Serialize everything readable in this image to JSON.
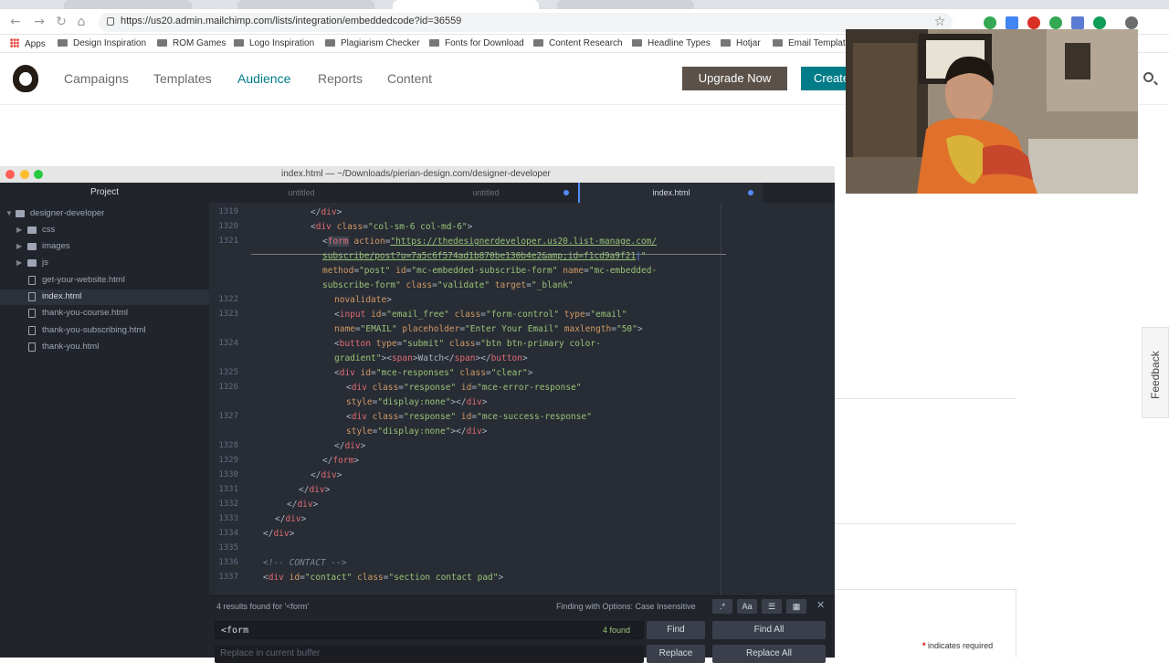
{
  "browser": {
    "url": "https://us20.admin.mailchimp.com/lists/integration/embeddedcode?id=36559",
    "bookmarks": [
      "Apps",
      "Design Inspiration",
      "ROM Games",
      "Logo Inspiration",
      "Plagiarism Checker",
      "Fonts for Download",
      "Content Research",
      "Headline Types",
      "Hotjar",
      "Email Templates"
    ]
  },
  "mailchimp": {
    "nav": [
      "Campaigns",
      "Templates",
      "Audience",
      "Reports",
      "Content"
    ],
    "active_nav": "Audience",
    "upgrade_label": "Upgrade Now",
    "create_label": "Create",
    "feedback_label": "Feedback",
    "required_note": "indicates required",
    "required_mark": "*"
  },
  "editor": {
    "window_title": "index.html — ~/Downloads/pierian-design.com/designer-developer",
    "tree_title": "Project",
    "tree": [
      {
        "label": "designer-developer",
        "kind": "root"
      },
      {
        "label": "css",
        "kind": "folder"
      },
      {
        "label": "images",
        "kind": "folder"
      },
      {
        "label": "js",
        "kind": "folder"
      },
      {
        "label": "get-your-website.html",
        "kind": "file"
      },
      {
        "label": "index.html",
        "kind": "file",
        "selected": true
      },
      {
        "label": "thank-you-course.html",
        "kind": "file"
      },
      {
        "label": "thank-you-subscribing.html",
        "kind": "file"
      },
      {
        "label": "thank-you.html",
        "kind": "file"
      }
    ],
    "tabs": [
      "untitled",
      "untitled",
      "index.html"
    ],
    "active_tab": "index.html",
    "line_numbers": [
      "1319",
      "1320",
      "1321",
      "",
      "",
      "1322",
      "1323",
      "",
      "1324",
      "",
      "1325",
      "1326",
      "",
      "1327",
      "",
      "1328",
      "1329",
      "1330",
      "1331",
      "1332",
      "1333",
      "1334",
      "1335",
      "1336",
      "1337"
    ],
    "find": {
      "results_text": "4 results found for '<form'",
      "options_text": "Finding with Options: Case Insensitive",
      "query": "<form",
      "found_text": "4 found",
      "find_label": "Find",
      "find_all_label": "Find All",
      "replace_placeholder": "Replace in current buffer",
      "replace_label": "Replace",
      "replace_all_label": "Replace All",
      "opt_regex": ".*",
      "opt_case": "Aa"
    }
  },
  "colors": {
    "mailchimp_teal": "#007c89",
    "upgrade_bg": "#5b5149",
    "editor_bg": "#282c34",
    "tag": "#e06c75",
    "attr": "#d19a66",
    "string": "#98c379"
  }
}
